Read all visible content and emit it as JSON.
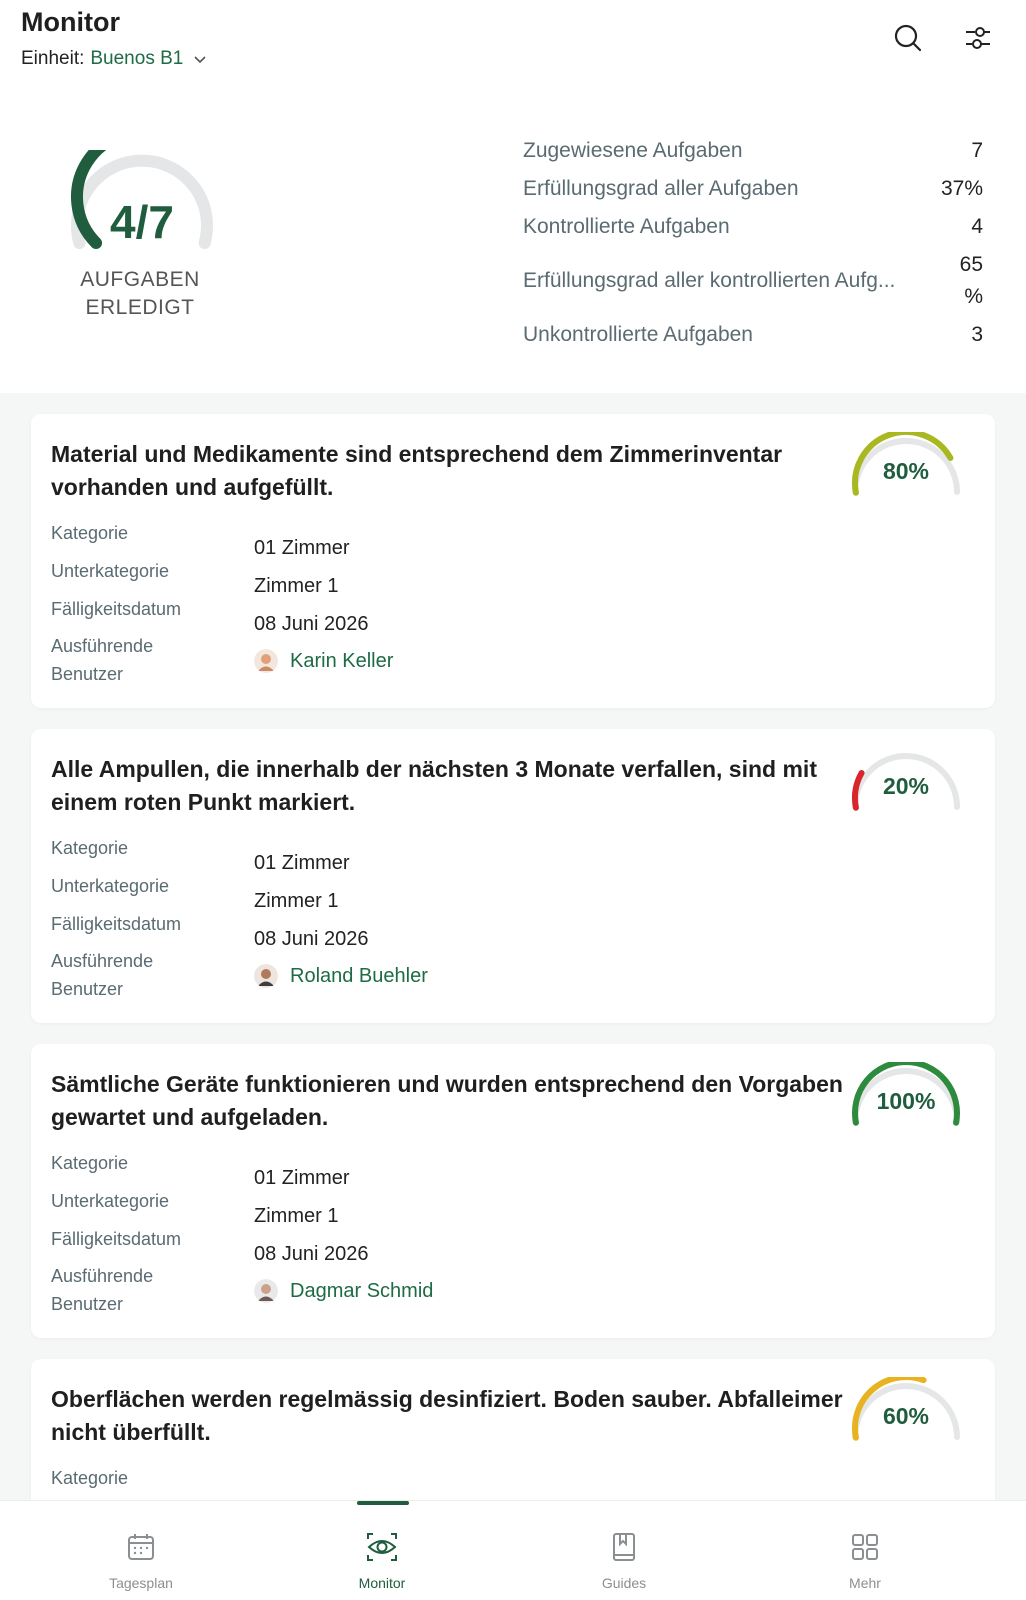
{
  "header": {
    "title": "Monitor",
    "unit_label": "Einheit:",
    "unit_value": "Buenos B1",
    "search_icon": "search-icon",
    "filter_icon": "sliders-icon"
  },
  "summary": {
    "done_text": "4/7",
    "done_fraction": 0.571,
    "label_line1": "AUFGABEN",
    "label_line2": "ERLEDIGT",
    "stats": [
      {
        "label": "Zugewiesene Aufgaben",
        "value": "7"
      },
      {
        "label": "Erfüllungsgrad aller Aufgaben",
        "value": "37%"
      },
      {
        "label": "Kontrollierte Aufgaben",
        "value": "4"
      },
      {
        "label": "Erfüllungsgrad aller kontrollierten Aufg...",
        "value": "65 %"
      },
      {
        "label": "Unkontrollierte Aufgaben",
        "value": "3"
      }
    ]
  },
  "field_labels": {
    "category": "Kategorie",
    "subcategory": "Unterkategorie",
    "due_date": "Fälligkeitsdatum",
    "executing_line1": "Ausführende",
    "executing_line2": "Benutzer"
  },
  "cards": [
    {
      "title": "Material und Medikamente sind entsprechend dem Zimmerinventar vorhanden und aufgefüllt.",
      "percent": "80%",
      "fraction": 0.8,
      "color": "#a9b820",
      "category": "01 Zimmer",
      "subcategory": "Zimmer 1",
      "due": "08 Juni 2026",
      "user": "Karin Keller"
    },
    {
      "title": "Alle Ampullen, die innerhalb der nächsten 3 Monate verfallen, sind mit einem roten Punkt markiert.",
      "percent": "20%",
      "fraction": 0.2,
      "color": "#d9262c",
      "category": "01 Zimmer",
      "subcategory": "Zimmer 1",
      "due": "08 Juni 2026",
      "user": "Roland Buehler"
    },
    {
      "title": "Sämtliche Geräte funktionieren und wurden entsprechend den Vorgaben gewartet und aufgeladen.",
      "percent": "100%",
      "fraction": 1.0,
      "color": "#2e8b3e",
      "category": "01 Zimmer",
      "subcategory": "Zimmer 1",
      "due": "08 Juni 2026",
      "user": "Dagmar Schmid"
    },
    {
      "title": "Oberflächen werden regelmässig desinfiziert. Boden sauber. Abfalleimer nicht überfüllt.",
      "percent": "60%",
      "fraction": 0.6,
      "color": "#e8b320",
      "category": "",
      "subcategory": "",
      "due": "",
      "user": ""
    }
  ],
  "nav": [
    {
      "label": "Tagesplan",
      "icon": "calendar-icon"
    },
    {
      "label": "Monitor",
      "icon": "eye-icon"
    },
    {
      "label": "Guides",
      "icon": "book-icon"
    },
    {
      "label": "Mehr",
      "icon": "grid-icon"
    }
  ],
  "colors": {
    "brand": "#1f5d3e",
    "link": "#1e6b45",
    "track": "#e4e6e7"
  }
}
